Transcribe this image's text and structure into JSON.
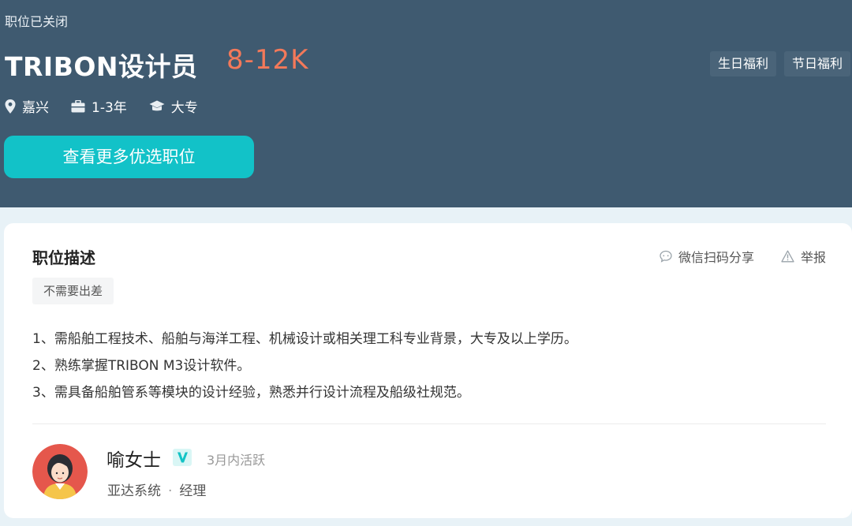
{
  "header": {
    "status": "职位已关闭",
    "title": "TRIBON设计员",
    "salary": "8-12K",
    "benefits": [
      "生日福利",
      "节日福利"
    ],
    "meta": {
      "location": "嘉兴",
      "experience": "1-3年",
      "education": "大专"
    },
    "more_button": "查看更多优选职位"
  },
  "description": {
    "title": "职位描述",
    "share": "微信扫码分享",
    "report": "举报",
    "travel_tag": "不需要出差",
    "lines": [
      "1、需船舶工程技术、船舶与海洋工程、机械设计或相关理工科专业背景，大专及以上学历。",
      "2、熟练掌握TRIBON M3设计软件。",
      "3、需具备船舶管系等模块的设计经验，熟悉并行设计流程及船级社规范。"
    ]
  },
  "recruiter": {
    "name": "喻女士",
    "active": "3月内活跃",
    "company": "亚达系统",
    "separator": "·",
    "role": "经理"
  },
  "colors": {
    "header_bg": "#3f5a70",
    "salary": "#f3795a",
    "button": "#12c2c8"
  }
}
